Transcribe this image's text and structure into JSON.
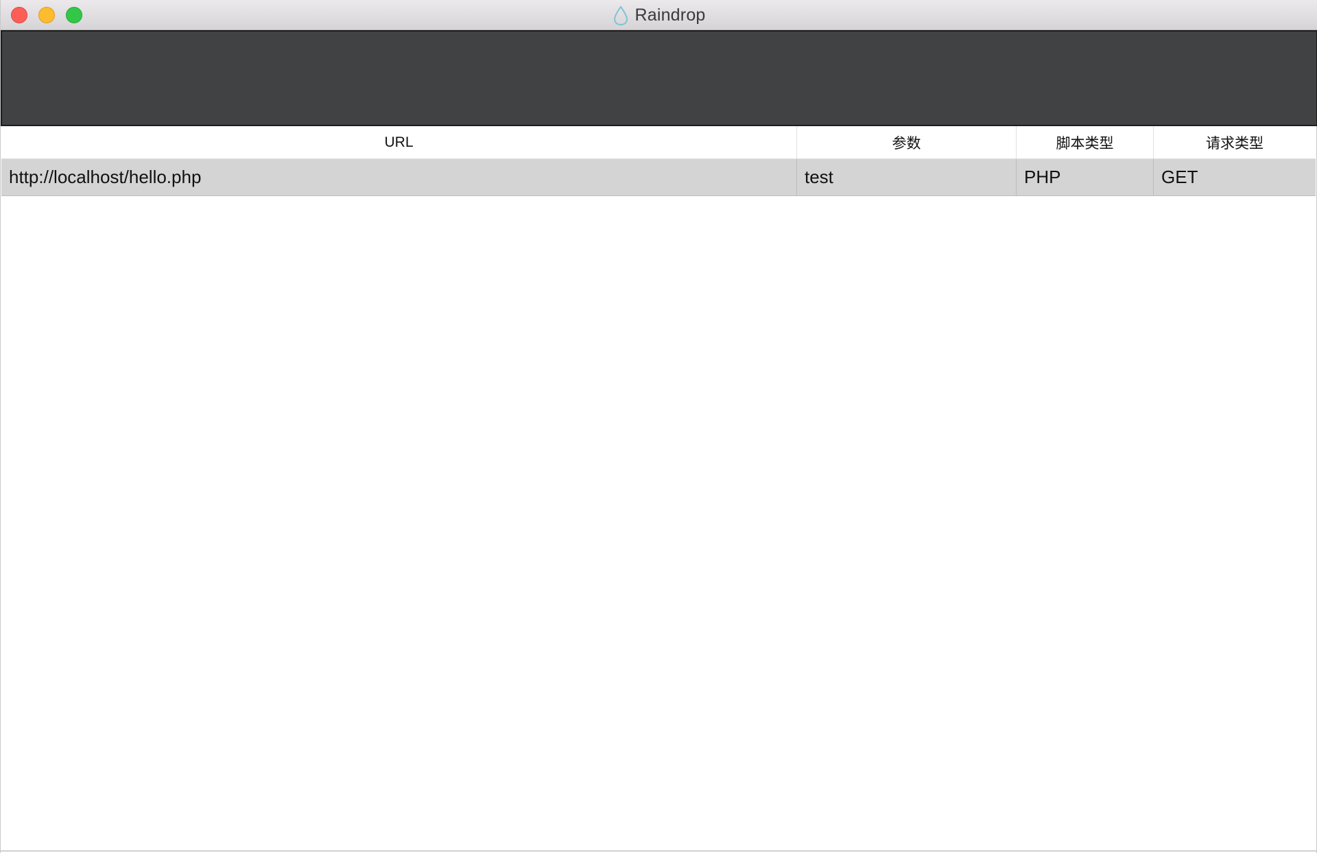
{
  "window": {
    "title": "Raindrop",
    "title_icon": "raindrop-icon",
    "traffic_lights": {
      "close_color": "#fc5e57",
      "minimize_color": "#fdbb2e",
      "maximize_color": "#33c748"
    }
  },
  "toolbar": {
    "background": "#414244"
  },
  "table": {
    "columns": [
      "URL",
      "参数",
      "脚本类型",
      "请求类型"
    ],
    "rows": [
      {
        "url": "http://localhost/hello.php",
        "params": "test",
        "script_type": "PHP",
        "request_type": "GET"
      }
    ],
    "selected_row_color": "#d4d4d4"
  }
}
